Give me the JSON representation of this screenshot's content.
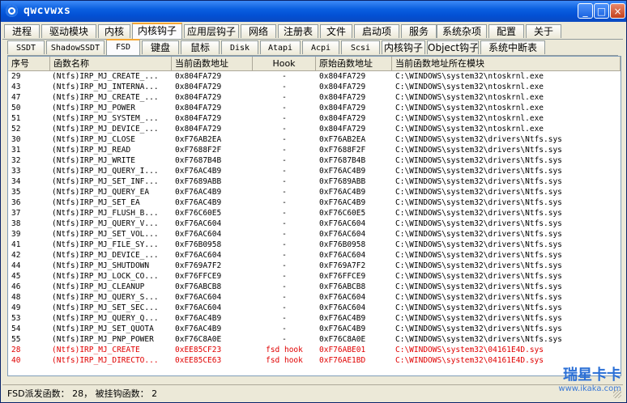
{
  "window": {
    "title": "qwcvwxs",
    "controls": {
      "minimize": "_",
      "maximize": "□",
      "close": "×"
    }
  },
  "main_tabs": [
    "进程",
    "驱动模块",
    "内核",
    "内核钩子",
    "应用层钩子",
    "网络",
    "注册表",
    "文件",
    "启动项",
    "服务",
    "系统杂项",
    "配置",
    "关于"
  ],
  "main_tab_selected": "内核钩子",
  "sub_tabs": [
    "SSDT",
    "ShadowSSDT",
    "FSD",
    "键盘",
    "鼠标",
    "Disk",
    "Atapi",
    "Acpi",
    "Scsi",
    "内核钩子",
    "Object钩子",
    "系统中断表"
  ],
  "sub_tab_selected": "FSD",
  "table": {
    "columns": [
      "序号",
      "函数名称",
      "当前函数地址",
      "Hook",
      "原始函数地址",
      "当前函数地址所在模块"
    ],
    "rows": [
      [
        "29",
        "(Ntfs)IRP_MJ_CREATE_...",
        "0x804FA729",
        "-",
        "0x804FA729",
        "C:\\WINDOWS\\system32\\ntoskrnl.exe"
      ],
      [
        "43",
        "(Ntfs)IRP_MJ_INTERNA...",
        "0x804FA729",
        "-",
        "0x804FA729",
        "C:\\WINDOWS\\system32\\ntoskrnl.exe"
      ],
      [
        "47",
        "(Ntfs)IRP_MJ_CREATE_...",
        "0x804FA729",
        "-",
        "0x804FA729",
        "C:\\WINDOWS\\system32\\ntoskrnl.exe"
      ],
      [
        "50",
        "(Ntfs)IRP_MJ_POWER",
        "0x804FA729",
        "-",
        "0x804FA729",
        "C:\\WINDOWS\\system32\\ntoskrnl.exe"
      ],
      [
        "51",
        "(Ntfs)IRP_MJ_SYSTEM_...",
        "0x804FA729",
        "-",
        "0x804FA729",
        "C:\\WINDOWS\\system32\\ntoskrnl.exe"
      ],
      [
        "52",
        "(Ntfs)IRP_MJ_DEVICE_...",
        "0x804FA729",
        "-",
        "0x804FA729",
        "C:\\WINDOWS\\system32\\ntoskrnl.exe"
      ],
      [
        "30",
        "(Ntfs)IRP_MJ_CLOSE",
        "0xF76AB2EA",
        "-",
        "0xF76AB2EA",
        "C:\\WINDOWS\\system32\\drivers\\Ntfs.sys"
      ],
      [
        "31",
        "(Ntfs)IRP_MJ_READ",
        "0xF7688F2F",
        "-",
        "0xF7688F2F",
        "C:\\WINDOWS\\system32\\drivers\\Ntfs.sys"
      ],
      [
        "32",
        "(Ntfs)IRP_MJ_WRITE",
        "0xF7687B4B",
        "-",
        "0xF7687B4B",
        "C:\\WINDOWS\\system32\\drivers\\Ntfs.sys"
      ],
      [
        "33",
        "(Ntfs)IRP_MJ_QUERY_I...",
        "0xF76AC4B9",
        "-",
        "0xF76AC4B9",
        "C:\\WINDOWS\\system32\\drivers\\Ntfs.sys"
      ],
      [
        "34",
        "(Ntfs)IRP_MJ_SET_INF...",
        "0xF7689ABB",
        "-",
        "0xF7689ABB",
        "C:\\WINDOWS\\system32\\drivers\\Ntfs.sys"
      ],
      [
        "35",
        "(Ntfs)IRP_MJ_QUERY_EA",
        "0xF76AC4B9",
        "-",
        "0xF76AC4B9",
        "C:\\WINDOWS\\system32\\drivers\\Ntfs.sys"
      ],
      [
        "36",
        "(Ntfs)IRP_MJ_SET_EA",
        "0xF76AC4B9",
        "-",
        "0xF76AC4B9",
        "C:\\WINDOWS\\system32\\drivers\\Ntfs.sys"
      ],
      [
        "37",
        "(Ntfs)IRP_MJ_FLUSH_B...",
        "0xF76C60E5",
        "-",
        "0xF76C60E5",
        "C:\\WINDOWS\\system32\\drivers\\Ntfs.sys"
      ],
      [
        "38",
        "(Ntfs)IRP_MJ_QUERY_V...",
        "0xF76AC604",
        "-",
        "0xF76AC604",
        "C:\\WINDOWS\\system32\\drivers\\Ntfs.sys"
      ],
      [
        "39",
        "(Ntfs)IRP_MJ_SET_VOL...",
        "0xF76AC604",
        "-",
        "0xF76AC604",
        "C:\\WINDOWS\\system32\\drivers\\Ntfs.sys"
      ],
      [
        "41",
        "(Ntfs)IRP_MJ_FILE_SY...",
        "0xF76B0958",
        "-",
        "0xF76B0958",
        "C:\\WINDOWS\\system32\\drivers\\Ntfs.sys"
      ],
      [
        "42",
        "(Ntfs)IRP_MJ_DEVICE_...",
        "0xF76AC604",
        "-",
        "0xF76AC604",
        "C:\\WINDOWS\\system32\\drivers\\Ntfs.sys"
      ],
      [
        "44",
        "(Ntfs)IRP_MJ_SHUTDOWN",
        "0xF769A7F2",
        "-",
        "0xF769A7F2",
        "C:\\WINDOWS\\system32\\drivers\\Ntfs.sys"
      ],
      [
        "45",
        "(Ntfs)IRP_MJ_LOCK_CO...",
        "0xF76FFCE9",
        "-",
        "0xF76FFCE9",
        "C:\\WINDOWS\\system32\\drivers\\Ntfs.sys"
      ],
      [
        "46",
        "(Ntfs)IRP_MJ_CLEANUP",
        "0xF76ABCB8",
        "-",
        "0xF76ABCB8",
        "C:\\WINDOWS\\system32\\drivers\\Ntfs.sys"
      ],
      [
        "48",
        "(Ntfs)IRP_MJ_QUERY_S...",
        "0xF76AC604",
        "-",
        "0xF76AC604",
        "C:\\WINDOWS\\system32\\drivers\\Ntfs.sys"
      ],
      [
        "49",
        "(Ntfs)IRP_MJ_SET_SEC...",
        "0xF76AC604",
        "-",
        "0xF76AC604",
        "C:\\WINDOWS\\system32\\drivers\\Ntfs.sys"
      ],
      [
        "53",
        "(Ntfs)IRP_MJ_QUERY_Q...",
        "0xF76AC4B9",
        "-",
        "0xF76AC4B9",
        "C:\\WINDOWS\\system32\\drivers\\Ntfs.sys"
      ],
      [
        "54",
        "(Ntfs)IRP_MJ_SET_QUOTA",
        "0xF76AC4B9",
        "-",
        "0xF76AC4B9",
        "C:\\WINDOWS\\system32\\drivers\\Ntfs.sys"
      ],
      [
        "55",
        "(Ntfs)IRP_MJ_PNP_POWER",
        "0xF76C8A0E",
        "-",
        "0xF76C8A0E",
        "C:\\WINDOWS\\system32\\drivers\\Ntfs.sys"
      ],
      [
        "28",
        "(Ntfs)IRP_MJ_CREATE",
        "0xEE85CF23",
        "fsd hook",
        "0xF76ABE01",
        "C:\\WINDOWS\\system32\\04161E4D.sys"
      ],
      [
        "40",
        "(Ntfs)IRP_MJ_DIRECTO...",
        "0xEE85CE63",
        "fsd hook",
        "0xF76AE1BD",
        "C:\\WINDOWS\\system32\\04161E4D.sys"
      ]
    ],
    "hooked_color": "#e00000"
  },
  "status": {
    "text": "FSD派发函数： 28， 被挂钩函数： 2"
  },
  "watermark": {
    "line1": "瑞星卡卡",
    "line2": "www.ikaka.com"
  }
}
